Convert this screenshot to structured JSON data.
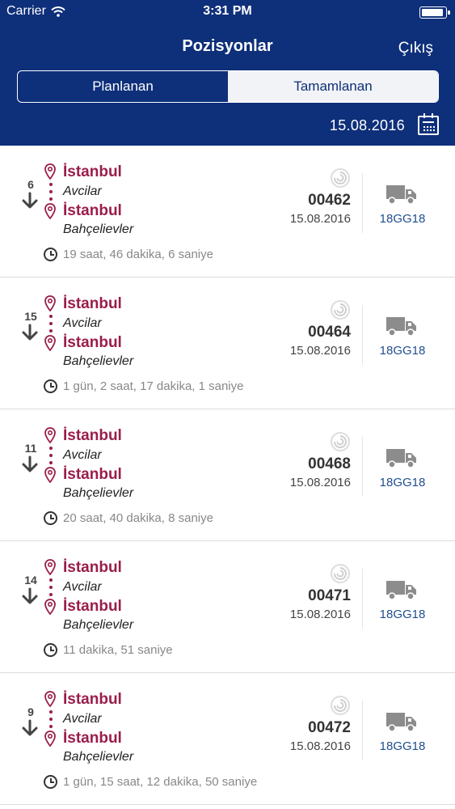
{
  "status_bar": {
    "carrier": "Carrier",
    "time": "3:31 PM",
    "wifi_icon": "wifi-icon",
    "battery_icon": "battery-icon"
  },
  "nav": {
    "title": "Pozisyonlar",
    "exit_label": "Çıkış"
  },
  "tabs": [
    {
      "label": "Planlanan",
      "selected": true
    },
    {
      "label": "Tamamlanan",
      "selected": false
    }
  ],
  "date": {
    "value": "15.08.2016",
    "icon": "calendar-icon"
  },
  "colors": {
    "header_bg": "#0e2f7a",
    "city": "#9a1d4a",
    "plate": "#1f4e8f"
  },
  "positions": [
    {
      "seq": "6",
      "from_city": "İstanbul",
      "from_district": "Avcilar",
      "to_city": "İstanbul",
      "to_district": "Bahçelievler",
      "duration": "19 saat, 46 dakika, 6 saniye",
      "order_no": "00462",
      "order_date": "15.08.2016",
      "plate": "18GG18"
    },
    {
      "seq": "15",
      "from_city": "İstanbul",
      "from_district": "Avcilar",
      "to_city": "İstanbul",
      "to_district": "Bahçelievler",
      "duration": "1 gün, 2 saat, 17 dakika, 1 saniye",
      "order_no": "00464",
      "order_date": "15.08.2016",
      "plate": "18GG18"
    },
    {
      "seq": "11",
      "from_city": "İstanbul",
      "from_district": "Avcilar",
      "to_city": "İstanbul",
      "to_district": "Bahçelievler",
      "duration": "20 saat, 40 dakika, 8 saniye",
      "order_no": "00468",
      "order_date": "15.08.2016",
      "plate": "18GG18"
    },
    {
      "seq": "14",
      "from_city": "İstanbul",
      "from_district": "Avcilar",
      "to_city": "İstanbul",
      "to_district": "Bahçelievler",
      "duration": "11 dakika, 51 saniye",
      "order_no": "00471",
      "order_date": "15.08.2016",
      "plate": "18GG18"
    },
    {
      "seq": "9",
      "from_city": "İstanbul",
      "from_district": "Avcilar",
      "to_city": "İstanbul",
      "to_district": "Bahçelievler",
      "duration": "1 gün, 15 saat, 12 dakika, 50 saniye",
      "order_no": "00472",
      "order_date": "15.08.2016",
      "plate": "18GG18"
    }
  ]
}
